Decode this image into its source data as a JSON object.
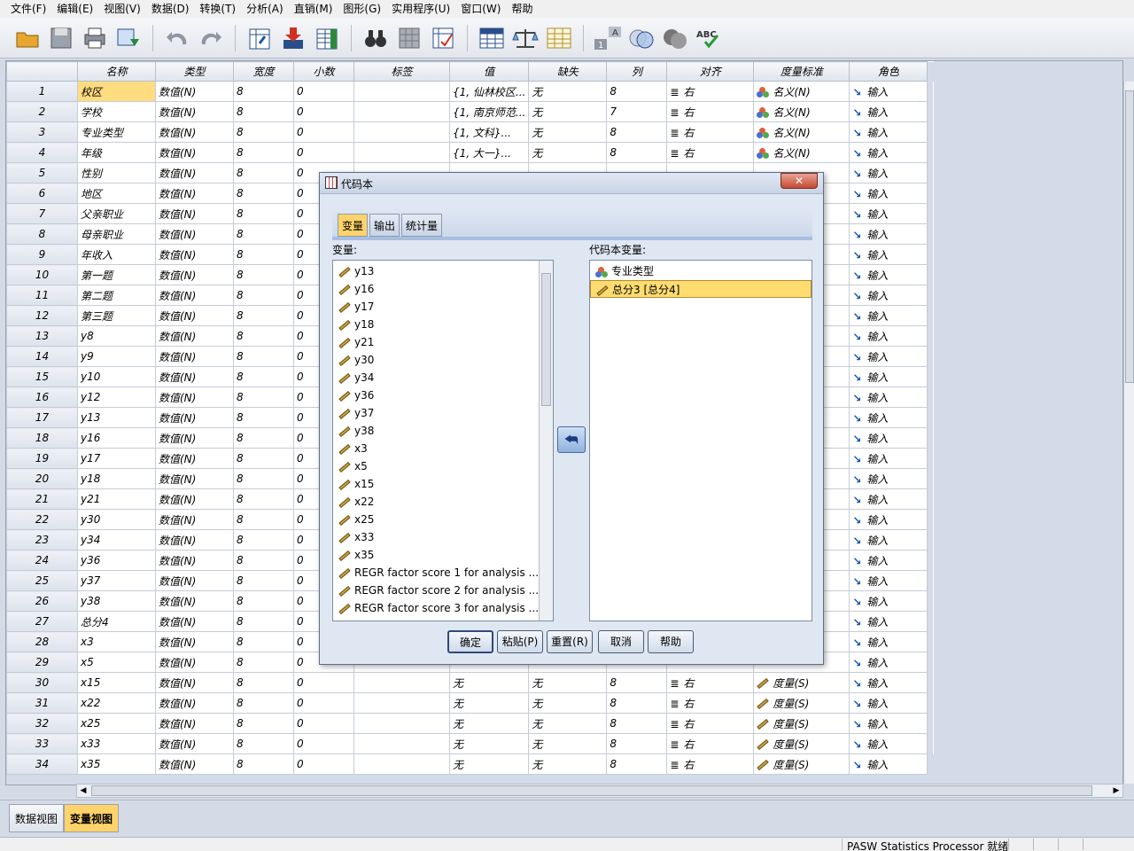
{
  "menu": [
    "文件(F)",
    "编辑(E)",
    "视图(V)",
    "数据(D)",
    "转换(T)",
    "分析(A)",
    "直销(M)",
    "图形(G)",
    "实用程序(U)",
    "窗口(W)",
    "帮助"
  ],
  "toolbar_icons": [
    "open-folder-icon",
    "save-icon",
    "print-icon",
    "dialog-recall-icon",
    "undo-icon",
    "redo-icon",
    "goto-case-icon",
    "goto-variable-icon",
    "variables-icon",
    "find-icon",
    "split-file-icon",
    "weight-cases-icon",
    "select-cases-icon",
    "value-labels-icon",
    "use-sets-icon",
    "show-all-icon",
    "spell-check-icon"
  ],
  "grid": {
    "headers": [
      "名称",
      "类型",
      "宽度",
      "小数",
      "标签",
      "值",
      "缺失",
      "列",
      "对齐",
      "度量标准",
      "角色"
    ],
    "rows": [
      [
        "1",
        "校区",
        "数值(N)",
        "8",
        "0",
        "",
        "{1, 仙林校区...",
        "无",
        "8",
        "右",
        "名义(N)",
        "输入",
        "nominal"
      ],
      [
        "2",
        "学校",
        "数值(N)",
        "8",
        "0",
        "",
        "{1, 南京师范...",
        "无",
        "7",
        "右",
        "名义(N)",
        "输入",
        "nominal"
      ],
      [
        "3",
        "专业类型",
        "数值(N)",
        "8",
        "0",
        "",
        "{1, 文科}...",
        "无",
        "8",
        "右",
        "名义(N)",
        "输入",
        "nominal"
      ],
      [
        "4",
        "年级",
        "数值(N)",
        "8",
        "0",
        "",
        "{1, 大一}...",
        "无",
        "8",
        "右",
        "名义(N)",
        "输入",
        "nominal"
      ],
      [
        "5",
        "性别",
        "数值(N)",
        "8",
        "0",
        "",
        "",
        "",
        "",
        "",
        "",
        "输入",
        "none"
      ],
      [
        "6",
        "地区",
        "数值(N)",
        "8",
        "0",
        "",
        "",
        "",
        "",
        "",
        "",
        "输入",
        "none"
      ],
      [
        "7",
        "父亲职业",
        "数值(N)",
        "8",
        "0",
        "",
        "",
        "",
        "",
        "",
        "",
        "输入",
        "none"
      ],
      [
        "8",
        "母亲职业",
        "数值(N)",
        "8",
        "0",
        "",
        "",
        "",
        "",
        "",
        "",
        "输入",
        "none"
      ],
      [
        "9",
        "年收入",
        "数值(N)",
        "8",
        "0",
        "",
        "",
        "",
        "",
        "",
        "",
        "输入",
        "none"
      ],
      [
        "10",
        "第一题",
        "数值(N)",
        "8",
        "0",
        "",
        "",
        "",
        "",
        "",
        "",
        "输入",
        "none"
      ],
      [
        "11",
        "第二题",
        "数值(N)",
        "8",
        "0",
        "",
        "",
        "",
        "",
        "",
        "",
        "输入",
        "none"
      ],
      [
        "12",
        "第三题",
        "数值(N)",
        "8",
        "0",
        "",
        "",
        "",
        "",
        "",
        "",
        "输入",
        "none"
      ],
      [
        "13",
        "y8",
        "数值(N)",
        "8",
        "0",
        "",
        "",
        "",
        "",
        "",
        "",
        "输入",
        "none"
      ],
      [
        "14",
        "y9",
        "数值(N)",
        "8",
        "0",
        "",
        "",
        "",
        "",
        "",
        "",
        "输入",
        "none"
      ],
      [
        "15",
        "y10",
        "数值(N)",
        "8",
        "0",
        "",
        "",
        "",
        "",
        "",
        "",
        "输入",
        "none"
      ],
      [
        "16",
        "y12",
        "数值(N)",
        "8",
        "0",
        "",
        "",
        "",
        "",
        "",
        "",
        "输入",
        "none"
      ],
      [
        "17",
        "y13",
        "数值(N)",
        "8",
        "0",
        "",
        "",
        "",
        "",
        "",
        "",
        "输入",
        "none"
      ],
      [
        "18",
        "y16",
        "数值(N)",
        "8",
        "0",
        "",
        "",
        "",
        "",
        "",
        "",
        "输入",
        "none"
      ],
      [
        "19",
        "y17",
        "数值(N)",
        "8",
        "0",
        "",
        "",
        "",
        "",
        "",
        "",
        "输入",
        "none"
      ],
      [
        "20",
        "y18",
        "数值(N)",
        "8",
        "0",
        "",
        "",
        "",
        "",
        "",
        "",
        "输入",
        "none"
      ],
      [
        "21",
        "y21",
        "数值(N)",
        "8",
        "0",
        "",
        "",
        "",
        "",
        "",
        "",
        "输入",
        "none"
      ],
      [
        "22",
        "y30",
        "数值(N)",
        "8",
        "0",
        "",
        "",
        "",
        "",
        "",
        "",
        "输入",
        "none"
      ],
      [
        "23",
        "y34",
        "数值(N)",
        "8",
        "0",
        "",
        "",
        "",
        "",
        "",
        "",
        "输入",
        "none"
      ],
      [
        "24",
        "y36",
        "数值(N)",
        "8",
        "0",
        "",
        "",
        "",
        "",
        "",
        "",
        "输入",
        "none"
      ],
      [
        "25",
        "y37",
        "数值(N)",
        "8",
        "0",
        "",
        "",
        "",
        "",
        "",
        "",
        "输入",
        "none"
      ],
      [
        "26",
        "y38",
        "数值(N)",
        "8",
        "0",
        "",
        "",
        "",
        "",
        "",
        "",
        "输入",
        "none"
      ],
      [
        "27",
        "总分4",
        "数值(N)",
        "8",
        "0",
        "",
        "",
        "",
        "",
        "",
        "",
        "输入",
        "none"
      ],
      [
        "28",
        "x3",
        "数值(N)",
        "8",
        "0",
        "",
        "",
        "",
        "",
        "",
        "",
        "输入",
        "none"
      ],
      [
        "29",
        "x5",
        "数值(N)",
        "8",
        "0",
        "",
        "",
        "",
        "",
        "",
        "",
        "输入",
        "none"
      ],
      [
        "30",
        "x15",
        "数值(N)",
        "8",
        "0",
        "",
        "无",
        "无",
        "8",
        "右",
        "度量(S)",
        "输入",
        "scale"
      ],
      [
        "31",
        "x22",
        "数值(N)",
        "8",
        "0",
        "",
        "无",
        "无",
        "8",
        "右",
        "度量(S)",
        "输入",
        "scale"
      ],
      [
        "32",
        "x25",
        "数值(N)",
        "8",
        "0",
        "",
        "无",
        "无",
        "8",
        "右",
        "度量(S)",
        "输入",
        "scale"
      ],
      [
        "33",
        "x33",
        "数值(N)",
        "8",
        "0",
        "",
        "无",
        "无",
        "8",
        "右",
        "度量(S)",
        "输入",
        "scale"
      ],
      [
        "34",
        "x35",
        "数值(N)",
        "8",
        "0",
        "",
        "无",
        "无",
        "8",
        "右",
        "度量(S)",
        "输入",
        "scale"
      ]
    ]
  },
  "tabs": {
    "data_view": "数据视图",
    "variable_view": "变量视图"
  },
  "status": {
    "text": "PASW Statistics Processor 就绪"
  },
  "dialog": {
    "title": "代码本",
    "close_label": "✕",
    "tabs": [
      "变量",
      "输出",
      "统计量"
    ],
    "variables_label": "变量:",
    "codebook_label": "代码本变量:",
    "variables": [
      "y13",
      "y16",
      "y17",
      "y18",
      "y21",
      "y30",
      "y34",
      "y36",
      "y37",
      "y38",
      "x3",
      "x5",
      "x15",
      "x22",
      "x25",
      "x33",
      "x35",
      "REGR factor score   1 for analysis    ...",
      "REGR factor score   2 for analysis    ...",
      "REGR factor score   3 for analysis    ..."
    ],
    "codebook_variables": [
      {
        "label": "专业类型",
        "icon": "nominal"
      },
      {
        "label": "总分3 [总分4]",
        "icon": "scale"
      }
    ],
    "move_arrow": "⮪",
    "buttons": {
      "ok": "确定",
      "paste": "粘贴(P)",
      "reset": "重置(R)",
      "cancel": "取消",
      "help": "帮助"
    }
  }
}
